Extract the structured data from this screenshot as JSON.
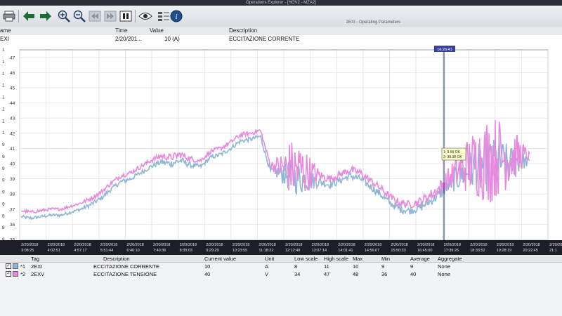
{
  "window": {
    "title": "Operations Explorer - [HOV2 - MZA2]",
    "subtitle": "2EXI - Operating Parameters"
  },
  "toolbar": {
    "icons": [
      "print-icon",
      "back-arrow-icon",
      "forward-arrow-icon",
      "zoom-in-icon",
      "zoom-out-icon",
      "rewind-icon",
      "fast-forward-icon",
      "pause-icon",
      "eye-icon",
      "grid-settings-icon",
      "info-icon"
    ]
  },
  "tag_header": {
    "name": "ame",
    "time": "Time",
    "value": "Value",
    "description": "Description"
  },
  "tag_row": {
    "name": "EXI",
    "time": "2/20/201...",
    "value": "10  (A)",
    "description": "ECCITAZIONE CORRENTE"
  },
  "colors": {
    "series1": "#8fb6d6",
    "series2": "#e889e0",
    "cursor": "#3a3f9a",
    "grid": "#e1e3e6"
  },
  "cursor": {
    "time": "16:26:41",
    "v1": "1: 9.55 OK",
    "v2": "2: 38.38 OK"
  },
  "chart_data": {
    "type": "line",
    "left_axis_ticks": [
      "47",
      "46",
      "45",
      "44",
      "43",
      "42",
      "41",
      "40",
      "39",
      "38",
      "37",
      "36",
      "35"
    ],
    "left_axis_prefixes": [
      "1",
      "1",
      "1",
      "1",
      "1",
      "1",
      "1",
      "1",
      "9",
      "9",
      "9",
      "9",
      "9",
      "9",
      "8",
      "8",
      "8"
    ],
    "x_labels": [
      {
        "date": "2/20/2018",
        "time": "3:08:25"
      },
      {
        "date": "2/20/2018",
        "time": "4:02:51"
      },
      {
        "date": "2/20/2018",
        "time": "4:57:17"
      },
      {
        "date": "2/20/2018",
        "time": "5:51:44"
      },
      {
        "date": "2/20/2018",
        "time": "6:46:10"
      },
      {
        "date": "2/20/2018",
        "time": "7:40:36"
      },
      {
        "date": "2/20/2018",
        "time": "8:35:03"
      },
      {
        "date": "2/20/2018",
        "time": "9:29:29"
      },
      {
        "date": "2/20/2018",
        "time": "10:23:55"
      },
      {
        "date": "2/20/2018",
        "time": "11:18:22"
      },
      {
        "date": "2/20/2018",
        "time": "12:12:48"
      },
      {
        "date": "2/20/2018",
        "time": "13:07:14"
      },
      {
        "date": "2/20/2018",
        "time": "14:01:41"
      },
      {
        "date": "2/20/2018",
        "time": "14:56:07"
      },
      {
        "date": "2/20/2018",
        "time": "15:50:33"
      },
      {
        "date": "2/20/2018",
        "time": "16:45:00"
      },
      {
        "date": "2/20/2018",
        "time": "17:39:26"
      },
      {
        "date": "2/20/2018",
        "time": "18:33:52"
      },
      {
        "date": "2/20/2018",
        "time": "19:28:19"
      },
      {
        "date": "2/20/2018",
        "time": "20:22:45"
      },
      {
        "date": "2/20/2018",
        "time": "21:1"
      }
    ],
    "ylim": [
      35,
      47.5
    ],
    "series": [
      {
        "name": "2EXI",
        "values": [
          36.5,
          36.4,
          36.5,
          36.6,
          36.6,
          36.8,
          37.0,
          37.3,
          37.7,
          38.3,
          38.8,
          39.0,
          39.4,
          39.8,
          40.1,
          40.0,
          40.2,
          39.9,
          39.8,
          40.4,
          40.6,
          41.0,
          41.5,
          41.6,
          41.8,
          39.5,
          39.4,
          39.2,
          39.0,
          38.9,
          38.8,
          38.6,
          38.9,
          39.2,
          39.0,
          38.5,
          38.0,
          37.4,
          37.0,
          36.9,
          37.1,
          37.5,
          38.0,
          38.7,
          39.2,
          39.6,
          39.8,
          39.9,
          40.1,
          40.0,
          40.2,
          40.1
        ],
        "noise": [
          0.1,
          0.1,
          0.1,
          0.1,
          0.1,
          0.1,
          0.1,
          0.15,
          0.15,
          0.15,
          0.15,
          0.15,
          0.15,
          0.15,
          0.2,
          0.25,
          0.25,
          0.2,
          0.15,
          0.15,
          0.15,
          0.15,
          0.15,
          0.15,
          0.15,
          0.2,
          0.6,
          1.1,
          1.1,
          0.7,
          0.3,
          0.25,
          0.25,
          0.25,
          0.25,
          0.25,
          0.25,
          0.25,
          0.25,
          0.25,
          0.3,
          0.3,
          0.4,
          0.6,
          1.0,
          1.3,
          1.6,
          1.8,
          1.6,
          1.2,
          0.8,
          0.2
        ]
      },
      {
        "name": "2EXV",
        "values": [
          36.9,
          36.8,
          36.9,
          37.0,
          37.0,
          37.2,
          37.4,
          37.7,
          38.1,
          38.7,
          39.2,
          39.4,
          39.8,
          40.2,
          40.5,
          40.4,
          40.6,
          40.3,
          40.2,
          40.8,
          41.0,
          41.4,
          41.9,
          42.0,
          42.2,
          39.9,
          39.8,
          39.7,
          39.6,
          39.4,
          39.2,
          39.0,
          39.3,
          39.6,
          39.4,
          38.9,
          38.4,
          37.8,
          37.4,
          37.3,
          37.5,
          37.9,
          38.4,
          39.1,
          39.6,
          40.0,
          40.2,
          40.3,
          40.5,
          40.4,
          40.6,
          40.5
        ],
        "noise": [
          0.1,
          0.1,
          0.1,
          0.1,
          0.1,
          0.1,
          0.1,
          0.15,
          0.15,
          0.15,
          0.15,
          0.15,
          0.15,
          0.15,
          0.2,
          0.25,
          0.25,
          0.2,
          0.15,
          0.15,
          0.15,
          0.15,
          0.15,
          0.15,
          0.15,
          0.2,
          0.9,
          1.9,
          1.9,
          1.1,
          0.35,
          0.25,
          0.25,
          0.25,
          0.25,
          0.25,
          0.25,
          0.25,
          0.25,
          0.25,
          0.3,
          0.35,
          0.5,
          0.8,
          1.4,
          2.0,
          2.6,
          3.0,
          2.6,
          2.0,
          1.2,
          0.2
        ]
      }
    ]
  },
  "legend": {
    "headers": [
      "Tag",
      "Description",
      "Current value",
      "Unit",
      "Low scale",
      "High scale",
      "Max",
      "Min",
      "Average",
      "Aggregate"
    ],
    "rows": [
      {
        "index": "*1",
        "tag": "2EXI",
        "description": "ECCITAZIONE CORRENTE",
        "current": "10",
        "unit": "A",
        "low": "8",
        "high": "11",
        "max": "10",
        "min": "9",
        "avg": "9",
        "agg": "None"
      },
      {
        "index": "*2",
        "tag": "2EXV",
        "description": "ECCITAZIONE TENSIONE",
        "current": "40",
        "unit": "V",
        "low": "34",
        "high": "47",
        "max": "48",
        "min": "36",
        "avg": "40",
        "agg": "None"
      }
    ]
  }
}
